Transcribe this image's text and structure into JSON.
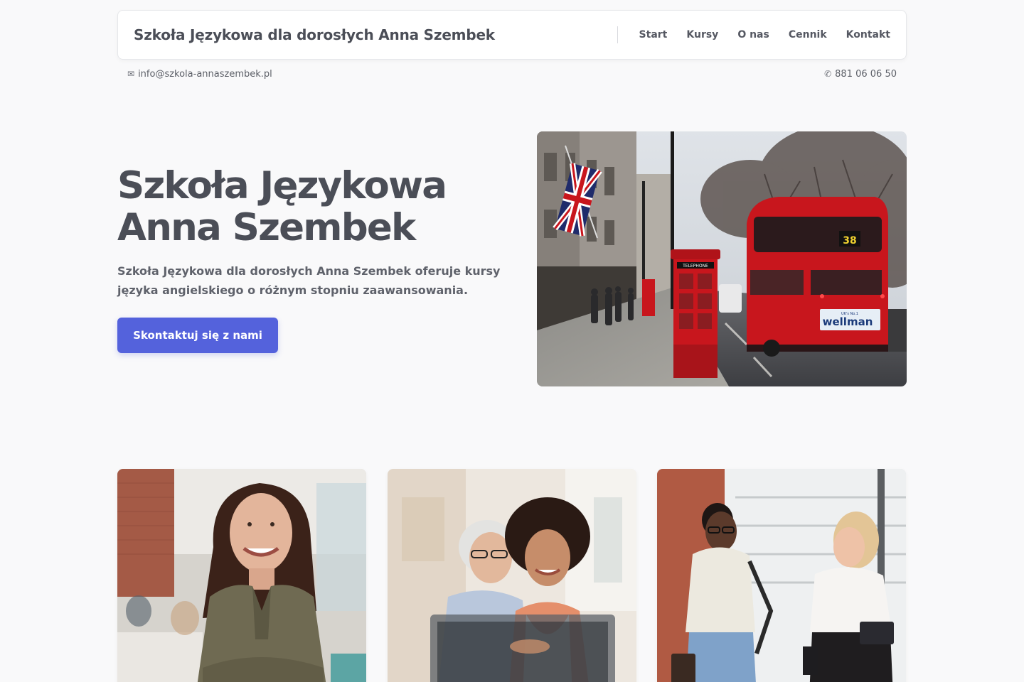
{
  "header": {
    "brand": "Szkoła Językowa dla dorosłych Anna Szembek",
    "nav": [
      "Start",
      "Kursy",
      "O nas",
      "Cennik",
      "Kontakt"
    ]
  },
  "topbar": {
    "email_icon": "✉",
    "email": "info@szkola-annaszembek.pl",
    "phone_icon": "✆",
    "phone": "881 06 06 50"
  },
  "hero": {
    "title_line1": "Szkoła Językowa",
    "title_line2": "Anna Szembek",
    "subtitle": "Szkoła Językowa dla dorosłych Anna Szembek oferuje kursy języka angielskiego o różnym stopniu zaawansowania.",
    "cta_label": "Skontaktuj się z nami",
    "image_text": {
      "phone_box_sign": "TELEPHONE",
      "bus_number": "38",
      "bus_ad": "wellman",
      "bus_ad_top": "UK's No.1"
    }
  },
  "colors": {
    "background": "#f9f9fa",
    "accent": "#5462dc",
    "text": "#4b4e57",
    "bus_red": "#c8161d"
  }
}
